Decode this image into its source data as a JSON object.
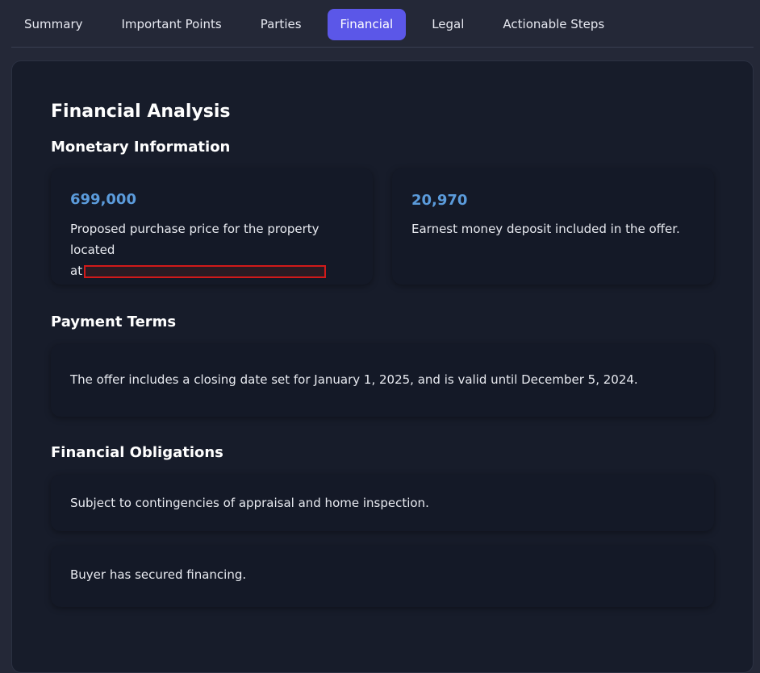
{
  "tabs": [
    {
      "label": "Summary",
      "active": false
    },
    {
      "label": "Important Points",
      "active": false
    },
    {
      "label": "Parties",
      "active": false
    },
    {
      "label": "Financial",
      "active": true
    },
    {
      "label": "Legal",
      "active": false
    },
    {
      "label": "Actionable Steps",
      "active": false
    }
  ],
  "financial": {
    "title": "Financial Analysis",
    "monetary": {
      "heading": "Monetary Information",
      "items": [
        {
          "amount": "699,000",
          "line1": "Proposed purchase price for the property located",
          "line2_prefix": "at"
        },
        {
          "amount": "20,970",
          "line1": "Earnest money deposit included in the offer."
        }
      ]
    },
    "payment_terms": {
      "heading": "Payment Terms",
      "text": "The offer includes a closing date set for January 1, 2025, and is valid until December 5, 2024."
    },
    "obligations": {
      "heading": "Financial Obligations",
      "items": [
        "Subject to contingencies of appraisal and home inspection.",
        "Buyer has secured financing."
      ]
    }
  },
  "colors": {
    "accent": "#5b57e8",
    "amount": "#5b9bdb",
    "background": "#242837",
    "panel": "#171c2a",
    "redaction": "#d11a1a"
  }
}
